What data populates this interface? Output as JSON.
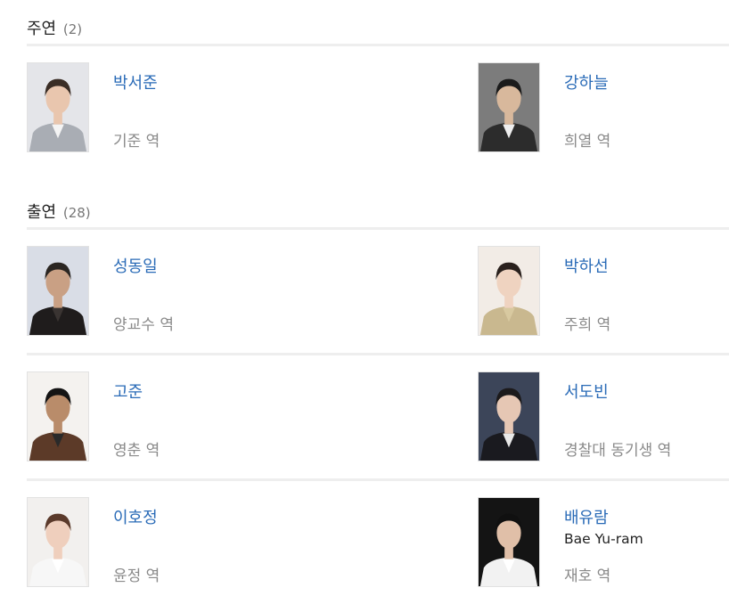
{
  "sections": [
    {
      "title": "주연",
      "count": "(2)",
      "rows": [
        [
          {
            "name": "박서준",
            "role": "기준 역",
            "photo": {
              "bg": "#e4e5e9",
              "skin": "#e9c6ae",
              "hair": "#3a2d25",
              "clothes": "#a9adb4",
              "inner": "#f4f4f4"
            }
          },
          {
            "name": "강하늘",
            "role": "희열 역",
            "photo": {
              "bg": "#7c7c7c",
              "skin": "#d8b89c",
              "hair": "#1b1b1b",
              "clothes": "#2c2c2c",
              "inner": "#eeeeee"
            }
          }
        ]
      ]
    },
    {
      "title": "출연",
      "count": "(28)",
      "rows": [
        [
          {
            "name": "성동일",
            "role": "양교수 역",
            "photo": {
              "bg": "#d9dde6",
              "skin": "#c9a084",
              "hair": "#2b2622",
              "clothes": "#1f1c1c",
              "inner": "#3a3432"
            }
          },
          {
            "name": "박하선",
            "role": "주희 역",
            "photo": {
              "bg": "#f2ece6",
              "skin": "#efd3c0",
              "hair": "#2a211d",
              "clothes": "#c9b88f",
              "inner": "#d8c9a0"
            }
          }
        ],
        [
          {
            "name": "고준",
            "role": "영춘 역",
            "photo": {
              "bg": "#f4f2ef",
              "skin": "#b98c6a",
              "hair": "#141414",
              "clothes": "#5c3a28",
              "inner": "#2a2a2a"
            }
          },
          {
            "name": "서도빈",
            "role": "경찰대 동기생 역",
            "photo": {
              "bg": "#3c4559",
              "skin": "#e6c7b4",
              "hair": "#1c1a1b",
              "clothes": "#1a1a1f",
              "inner": "#e8e8e8"
            }
          }
        ],
        [
          {
            "name": "이호정",
            "role": "윤정 역",
            "photo": {
              "bg": "#f2f0ee",
              "skin": "#efcfbd",
              "hair": "#5b3a2b",
              "clothes": "#f7f7f7",
              "inner": "#ffffff"
            }
          },
          {
            "name": "배유람",
            "subtitle": "Bae Yu-ram",
            "role": "재호 역",
            "photo": {
              "bg": "#141414",
              "skin": "#e0bfa8",
              "hair": "#101010",
              "clothes": "#f2f2f2",
              "inner": "#ffffff"
            }
          }
        ]
      ]
    }
  ]
}
